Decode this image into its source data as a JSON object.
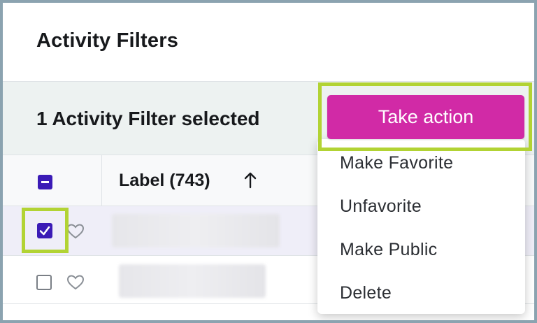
{
  "page": {
    "title": "Activity Filters"
  },
  "selection_bar": {
    "text": "1 Activity Filter selected",
    "action_button": "Take action"
  },
  "table": {
    "header": {
      "label_column": "Label (743)",
      "sort": "ascending"
    },
    "rows": [
      {
        "checked": true,
        "favorite": false
      },
      {
        "checked": false,
        "favorite": false
      }
    ]
  },
  "menu": {
    "items": [
      "Make Favorite",
      "Unfavorite",
      "Make Public",
      "Delete"
    ]
  },
  "colors": {
    "accent_button": "#d12aa6",
    "checkbox": "#3b1bb6",
    "highlight": "#b2d334"
  }
}
